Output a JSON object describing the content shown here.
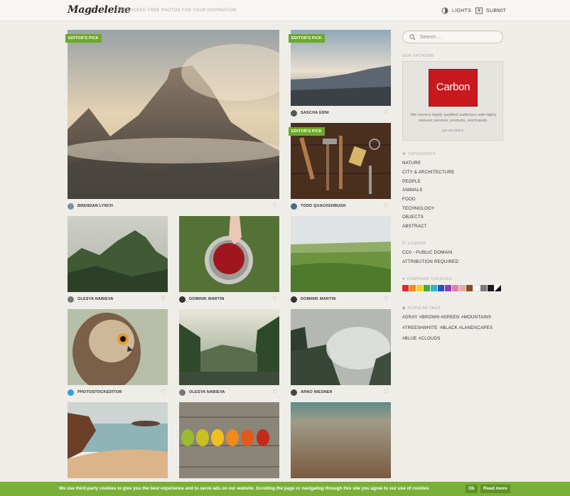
{
  "header": {
    "logo": "Magdeleine",
    "tagline": "HAND-PICKED FREE PHOTOS FOR YOUR INSPIRATION",
    "lights_label": "LIGHTS",
    "submit_label": "SUBMIT"
  },
  "editor_pick_label": "EDITOR'S PICK",
  "photos": [
    {
      "author": "BRENDAN LYNCH",
      "editors_pick": true,
      "icon": "half-dome-mountain-in-fog"
    },
    {
      "author": "SASCHA ERNI",
      "editors_pick": true,
      "icon": "misty-valley-sunrise"
    },
    {
      "author": "TODD QUACKENBUSH",
      "editors_pick": true,
      "icon": "vintage-tools-on-wood"
    },
    {
      "author": "OLESYA NABIEVA",
      "editors_pick": false,
      "icon": "green-mountains"
    },
    {
      "author": "DOMINIK MARTIN",
      "editors_pick": false,
      "icon": "bowl-of-berries"
    },
    {
      "author": "DOMINIK MARTIN",
      "editors_pick": false,
      "icon": "wheat-field"
    },
    {
      "author": "PHOTOSTOCKEDITOR",
      "editors_pick": false,
      "icon": "owl"
    },
    {
      "author": "OLESYA NABIEVA",
      "editors_pick": false,
      "icon": "forest-lake"
    },
    {
      "author": "ARNO NIESNER",
      "editors_pick": false,
      "icon": "foggy-forest"
    },
    {
      "author": "",
      "editors_pick": false,
      "icon": "beach-cove"
    },
    {
      "author": "",
      "editors_pick": false,
      "icon": "autumn-leaves-row"
    },
    {
      "author": "",
      "editors_pick": false,
      "icon": "sand-closeup"
    }
  ],
  "sidebar": {
    "search_placeholder": "Search ...",
    "sponsor_heading": "OUR SPONSOR",
    "sponsor_brand": "Carbon",
    "sponsor_text": "We connect highly qualified audiences with highly relevant services, products, and brands.",
    "sponsor_via": "ads via Carbon",
    "categories_heading": "CATEGORIES",
    "categories": [
      "NATURE",
      "CITY & ARCHITECTURE",
      "PEOPLE",
      "ANIMALS",
      "FOOD",
      "TECHNOLOGY",
      "OBJECTS",
      "ABSTRACT"
    ],
    "license_heading": "LICENSE",
    "licenses": [
      "CC0 - PUBLIC DOMAIN",
      "ATTRIBUTION REQUIRED"
    ],
    "colours_heading": "DOMINANT COLOURS",
    "colours": [
      "#e8262b",
      "#f28c1a",
      "#f2d21c",
      "#3fae3f",
      "#2fb5c8",
      "#2d4fc6",
      "#8a3fb8",
      "#e87aa8",
      "#e8a9a0",
      "#8b4a26",
      "#ffffff",
      "#7a7a7a",
      "#1c1c1c",
      "#bw"
    ],
    "tags_heading": "POPULAR TAGS",
    "tags_row1": [
      "#GRAY",
      "#BROWN",
      "#GREEN",
      "#MOUNTAINS"
    ],
    "tags_row2": [
      "#TREES",
      "#WHITE",
      "#BLACK",
      "#LANDSCAPES"
    ],
    "tags_row3": [
      "#BLUE",
      "#CLOUDS"
    ]
  },
  "cookie": {
    "text": "We use third-party cookies to give you the best experience and to serve ads on our website. Scrolling the page or navigating through this site you agree to our use of cookies",
    "ok_label": "Ok",
    "read_more_label": "Read more"
  }
}
